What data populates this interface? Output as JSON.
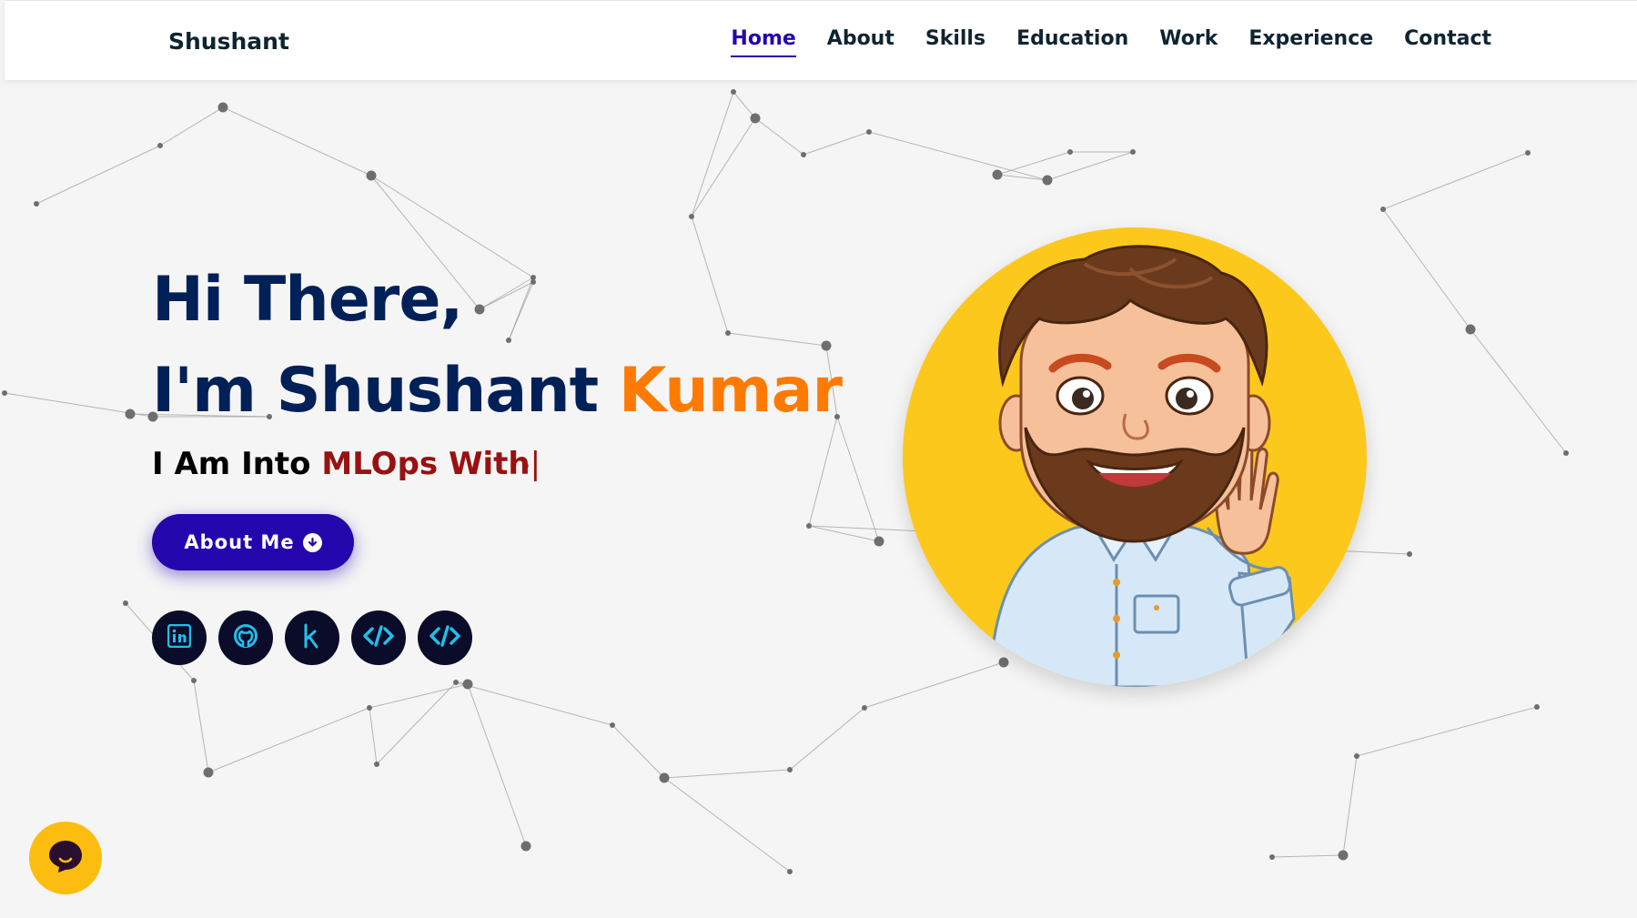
{
  "brand": "Shushant",
  "nav": {
    "items": [
      {
        "label": "Home",
        "active": true
      },
      {
        "label": "About"
      },
      {
        "label": "Skills"
      },
      {
        "label": "Education"
      },
      {
        "label": "Work"
      },
      {
        "label": "Experience"
      },
      {
        "label": "Contact"
      }
    ]
  },
  "hero": {
    "greeting": "Hi There,",
    "name_prefix": "I'm Shushant ",
    "name_accent": "Kumar",
    "typed_prefix": "I Am Into ",
    "typed_word": "MLOps With",
    "caret": "|",
    "about_button": "About Me"
  },
  "socials": [
    {
      "icon": "linkedin-icon"
    },
    {
      "icon": "github-icon"
    },
    {
      "icon": "kaggle-icon"
    },
    {
      "icon": "code-icon"
    },
    {
      "icon": "code-icon"
    }
  ],
  "colors": {
    "primary": "#2506ad",
    "accent": "#ff7a00",
    "heading": "#002057",
    "typed": "#991111",
    "avatar_bg": "#fdc81c",
    "social_icon": "#1ec1e8"
  }
}
